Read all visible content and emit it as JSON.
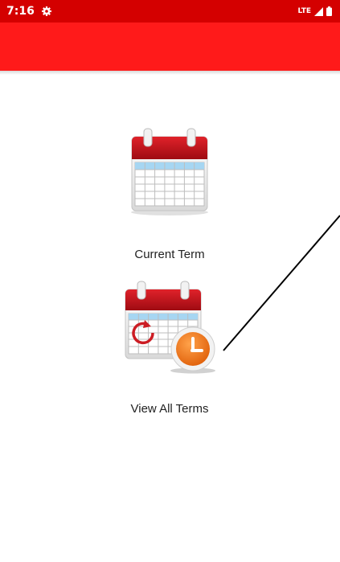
{
  "status_bar": {
    "time": "7:16",
    "network": "LTE",
    "icons": [
      "settings-icon",
      "signal-icon",
      "battery-icon"
    ]
  },
  "app_bar": {
    "color": "#ff1a1a"
  },
  "menu": {
    "current_term_label": "Current Term",
    "view_all_terms_label": "View All Terms",
    "current_term_icon": "calendar-icon",
    "view_all_terms_icon": "calendar-clock-icon"
  },
  "colors": {
    "status_bar": "#d40000",
    "accent_red": "#ff1a1a",
    "clock_orange": "#f07a1a"
  }
}
